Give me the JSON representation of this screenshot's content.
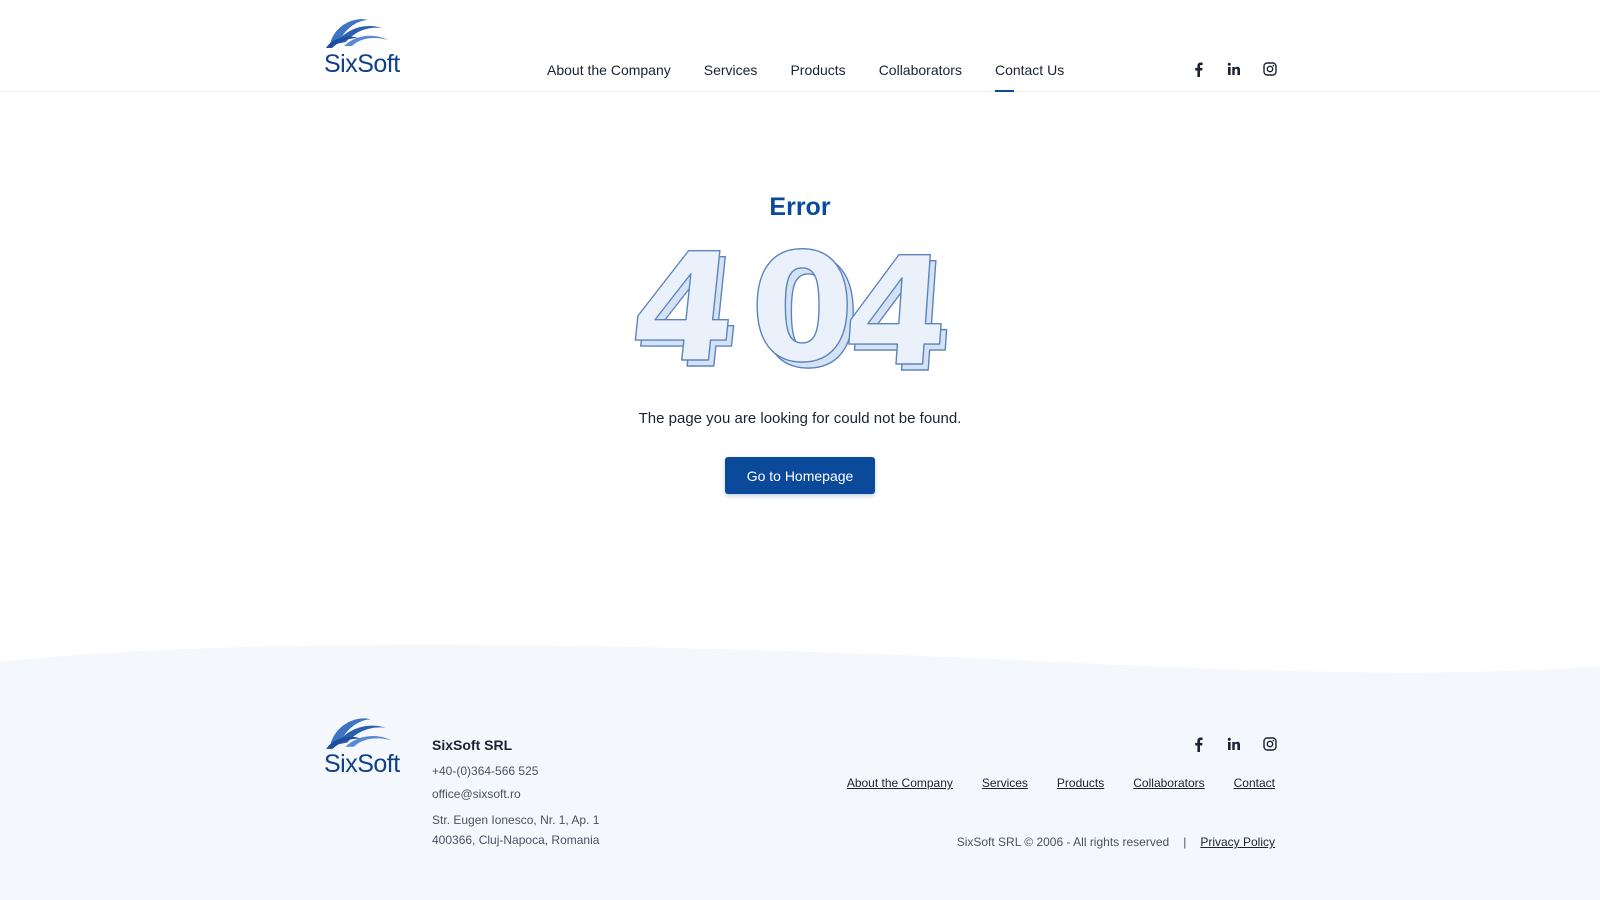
{
  "brand": {
    "name": "SixSoft",
    "primary_color": "#0b4a9a",
    "footer_bg": "#f4f7fb"
  },
  "header": {
    "nav": [
      {
        "label": "About the Company",
        "active": false
      },
      {
        "label": "Services",
        "active": false
      },
      {
        "label": "Products",
        "active": false
      },
      {
        "label": "Collaborators",
        "active": false
      },
      {
        "label": "Contact Us",
        "active": true
      }
    ],
    "social": [
      "facebook-icon",
      "linkedin-icon",
      "instagram-icon"
    ]
  },
  "main": {
    "title": "Error",
    "code": "404",
    "message": "The page you are looking for could not be found.",
    "button_label": "Go to Homepage"
  },
  "footer": {
    "company_name": "SixSoft SRL",
    "phone": "+40-(0)364-566 525",
    "email": "office@sixsoft.ro",
    "address_line1": "Str. Eugen Ionesco, Nr. 1, Ap. 1",
    "address_line2": "400366, Cluj-Napoca, Romania",
    "links": [
      "About the Company",
      "Services",
      "Products",
      "Collaborators",
      "Contact"
    ],
    "copyright": "SixSoft SRL © 2006 - All rights reserved",
    "separator": "|",
    "privacy": "Privacy Policy"
  }
}
